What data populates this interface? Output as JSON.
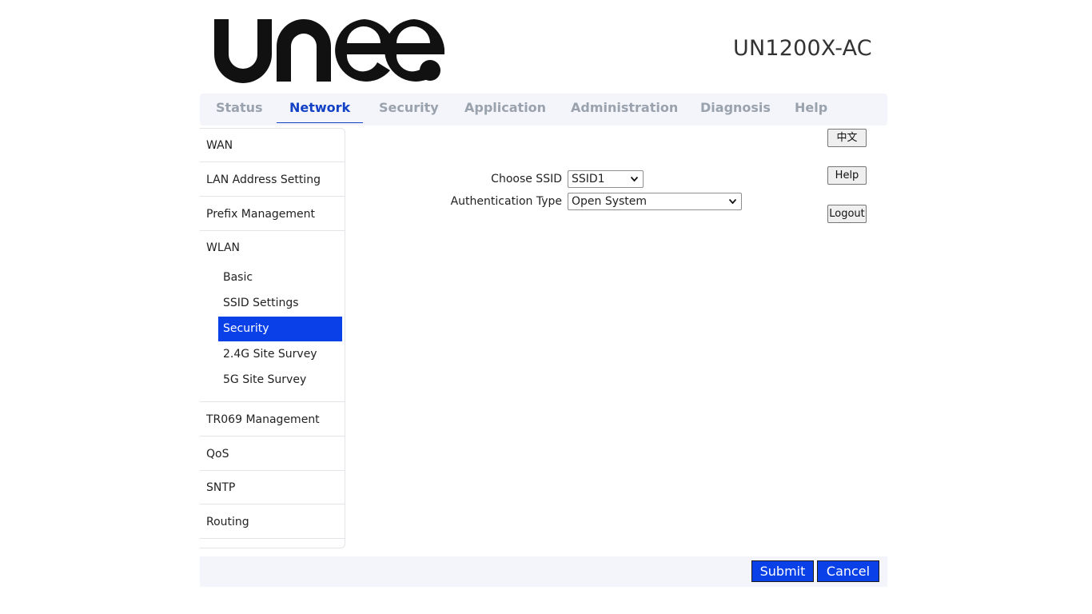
{
  "brand": {
    "logo_text": "UNee",
    "model": "UN1200X-AC"
  },
  "topnav": {
    "tabs": [
      {
        "label": "Status"
      },
      {
        "label": "Network",
        "active": true
      },
      {
        "label": "Security"
      },
      {
        "label": "Application"
      },
      {
        "label": "Administration"
      },
      {
        "label": "Diagnosis"
      },
      {
        "label": "Help"
      }
    ]
  },
  "sidebar": {
    "items": [
      {
        "label": "WAN"
      },
      {
        "label": "LAN Address Setting"
      },
      {
        "label": "Prefix Management"
      },
      {
        "label": "WLAN"
      },
      {
        "label": "TR069 Management"
      },
      {
        "label": "QoS"
      },
      {
        "label": "SNTP"
      },
      {
        "label": "Routing"
      }
    ],
    "wlan_sub": [
      {
        "label": "Basic"
      },
      {
        "label": "SSID Settings"
      },
      {
        "label": "Security",
        "active": true
      },
      {
        "label": "2.4G Site Survey"
      },
      {
        "label": "5G Site Survey"
      }
    ]
  },
  "right_buttons": {
    "lang": "中文",
    "help": "Help",
    "logout": "Logout"
  },
  "form": {
    "ssid_label": "Choose SSID",
    "ssid_value": "SSID1",
    "auth_label": "Authentication Type",
    "auth_value": "Open System"
  },
  "footer": {
    "submit": "Submit",
    "cancel": "Cancel"
  },
  "colors": {
    "accent": "#0a40e8",
    "active_tab": "#1241c6",
    "inactive_tab": "#9aa2ad"
  }
}
